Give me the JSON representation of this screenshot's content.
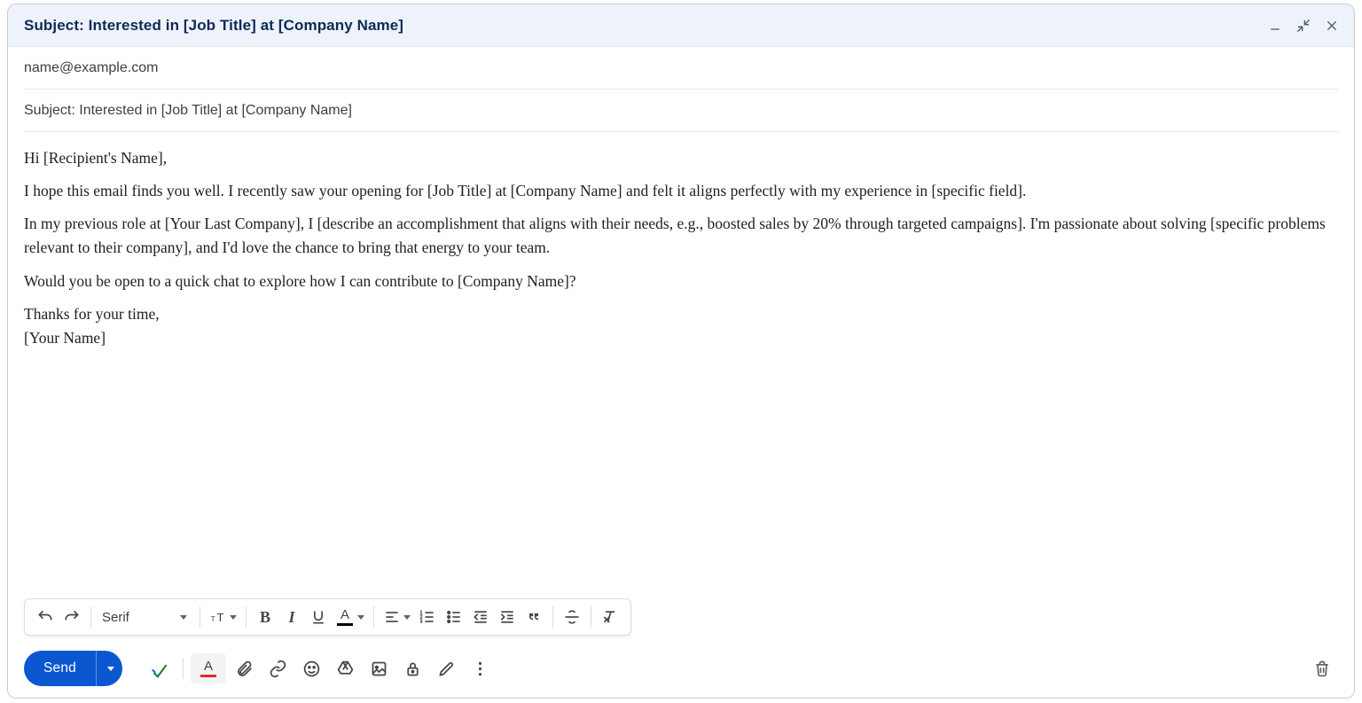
{
  "titleBar": {
    "title": "Subject: Interested in [Job Title] at [Company Name]"
  },
  "fields": {
    "to": "name@example.com",
    "subject": "Subject: Interested in [Job Title] at [Company Name]"
  },
  "body": {
    "greeting": "Hi [Recipient's Name],",
    "p1": "I hope this email finds you well. I recently saw your opening for [Job Title] at [Company Name] and felt it aligns perfectly with my experience in [specific field].",
    "p2": "In my previous role at [Your Last Company], I [describe an accomplishment that aligns with their needs, e.g., boosted sales by 20% through targeted campaigns]. I'm passionate about solving [specific problems relevant to their company], and I'd love the chance to bring that energy to your team.",
    "p3": "Would you be open to a quick chat to explore how I can contribute to [Company Name]?",
    "closing1": "Thanks for your time,",
    "closing2": "[Your Name]"
  },
  "formatBar": {
    "fontName": "Serif"
  },
  "sendBar": {
    "sendLabel": "Send"
  }
}
